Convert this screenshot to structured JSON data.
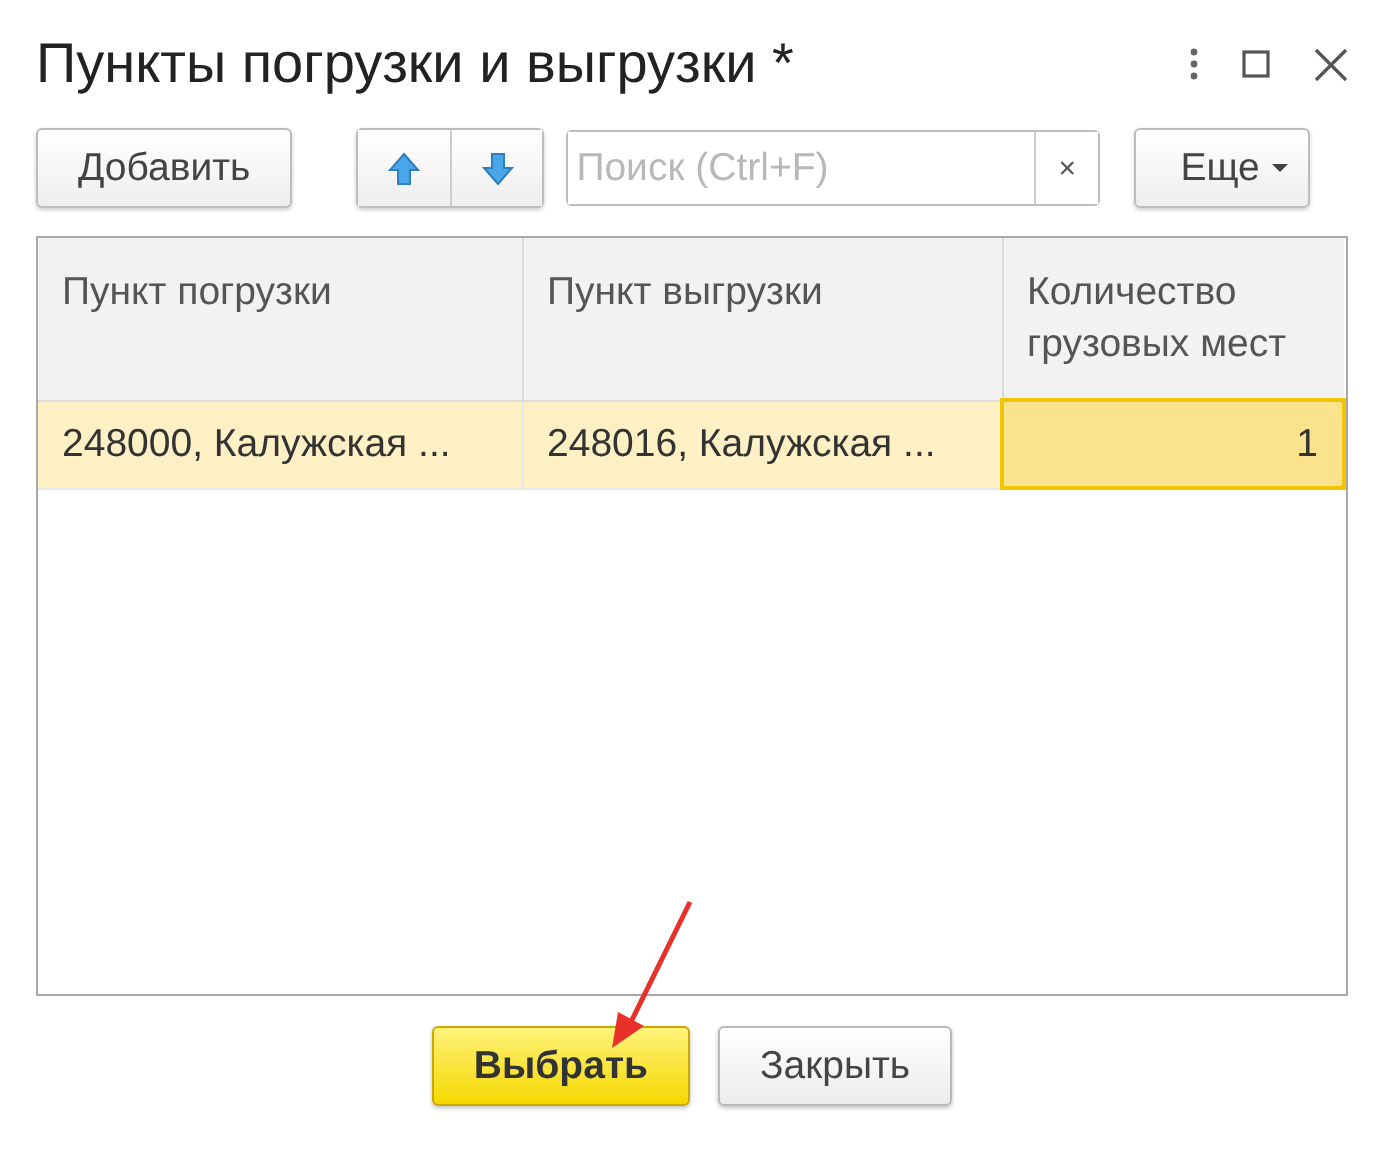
{
  "window": {
    "title": "Пункты погрузки и выгрузки *"
  },
  "toolbar": {
    "add_button": "Добавить",
    "search": {
      "placeholder": "Поиск (Ctrl+F)",
      "clear": "×"
    },
    "more_button": "Еще"
  },
  "table": {
    "columns": [
      {
        "label": "Пункт погрузки"
      },
      {
        "label": "Пункт выгрузки"
      },
      {
        "label": "Количество грузовых мест"
      }
    ],
    "rows": [
      {
        "selected": true,
        "cells": [
          {
            "text": "248000, Калужская ...",
            "focused": false
          },
          {
            "text": "248016, Калужская ...",
            "focused": false
          },
          {
            "text": "1",
            "focused": true
          }
        ]
      }
    ]
  },
  "buttons": [
    {
      "label": "Выбрать",
      "kind": "default"
    },
    {
      "label": "Закрыть",
      "kind": "normal"
    }
  ]
}
